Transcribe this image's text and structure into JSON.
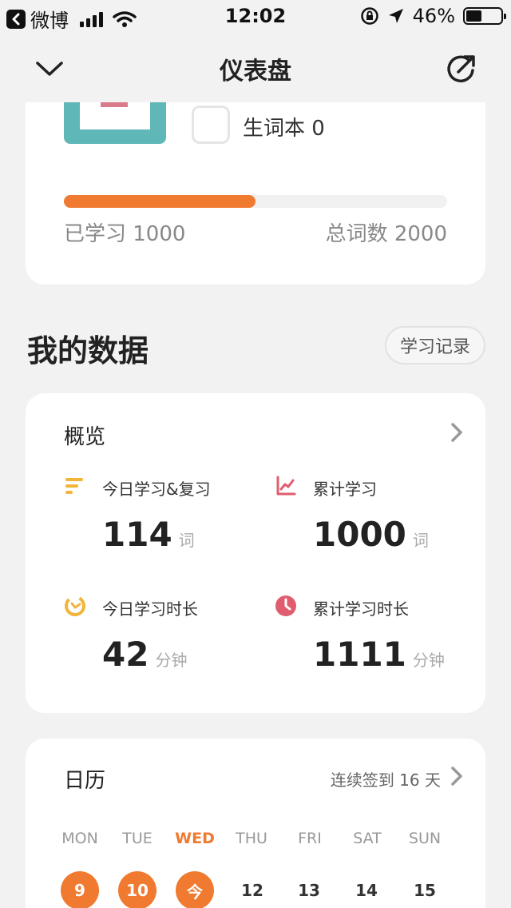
{
  "status_bar": {
    "back_app": "微博",
    "time": "12:02",
    "battery_percent": "46%",
    "battery_level": 0.46
  },
  "nav": {
    "title": "仪表盘"
  },
  "book": {
    "vocab_label": "生词本 0",
    "learned": "已学习 1000",
    "total": "总词数 2000",
    "progress": 0.5
  },
  "my_data": {
    "title": "我的数据",
    "record_button": "学习记录"
  },
  "overview": {
    "title": "概览",
    "stats": [
      {
        "label": "今日学习&复习",
        "value": "114",
        "unit": "词",
        "icon": "bars-icon",
        "color": "#f2b53a"
      },
      {
        "label": "累计学习",
        "value": "1000",
        "unit": "词",
        "icon": "chart-icon",
        "color": "#e05d6f"
      },
      {
        "label": "今日学习时长",
        "value": "42",
        "unit": "分钟",
        "icon": "clock-dial-icon",
        "color": "#f2b53a"
      },
      {
        "label": "累计学习时长",
        "value": "1111",
        "unit": "分钟",
        "icon": "clock-icon",
        "color": "#e05d6f"
      }
    ]
  },
  "calendar": {
    "title": "日历",
    "streak": "连续签到 16 天",
    "weekdays": [
      "MON",
      "TUE",
      "WED",
      "THU",
      "FRI",
      "SAT",
      "SUN"
    ],
    "dates": [
      "9",
      "10",
      "今",
      "12",
      "13",
      "14",
      "15"
    ],
    "accent": "#f07a2f"
  }
}
